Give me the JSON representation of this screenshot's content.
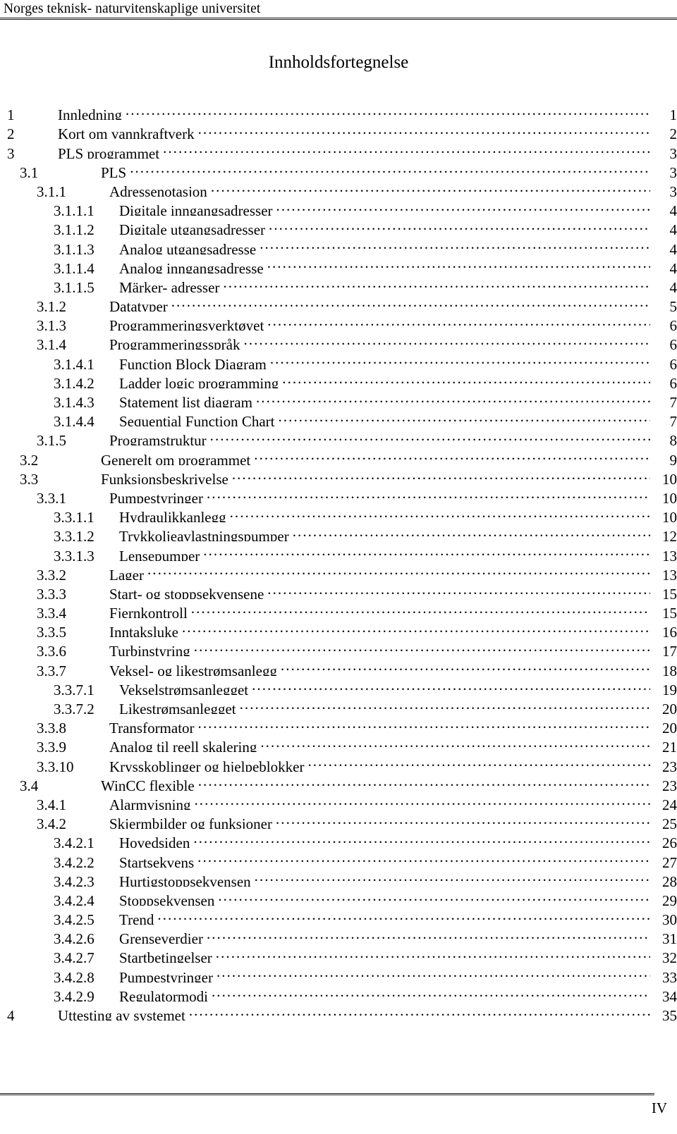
{
  "header": {
    "institution": "Norges teknisk- naturvitenskaplige universitet"
  },
  "title": "Innholdsfortegnelse",
  "footer": {
    "page_number": "IV"
  },
  "toc": {
    "entries": [
      {
        "level": 1,
        "number": "1",
        "title": "Innledning",
        "page": "1"
      },
      {
        "level": 1,
        "number": "2",
        "title": "Kort om vannkraftverk",
        "page": "2"
      },
      {
        "level": 1,
        "number": "3",
        "title": "PLS programmet",
        "page": "3"
      },
      {
        "level": 2,
        "number": "3.1",
        "title": "PLS",
        "page": "3"
      },
      {
        "level": 3,
        "number": "3.1.1",
        "title": "Adressenotasjon",
        "page": "3"
      },
      {
        "level": 4,
        "number": "3.1.1.1",
        "title": "Digitale inngangsadresser",
        "page": "4"
      },
      {
        "level": 4,
        "number": "3.1.1.2",
        "title": "Digitale utgangsadresser",
        "page": "4"
      },
      {
        "level": 4,
        "number": "3.1.1.3",
        "title": "Analog utgangsadresse",
        "page": "4"
      },
      {
        "level": 4,
        "number": "3.1.1.4",
        "title": "Analog inngangsadresse",
        "page": "4"
      },
      {
        "level": 4,
        "number": "3.1.1.5",
        "title": "Märker- adresser",
        "page": "4"
      },
      {
        "level": 3,
        "number": "3.1.2",
        "title": "Datatyper",
        "page": "5"
      },
      {
        "level": 3,
        "number": "3.1.3",
        "title": "Programmeringsverktøyet",
        "page": "6"
      },
      {
        "level": 3,
        "number": "3.1.4",
        "title": "Programmeringsspråk",
        "page": "6"
      },
      {
        "level": 4,
        "number": "3.1.4.1",
        "title": "Function Block Diagram",
        "page": "6"
      },
      {
        "level": 4,
        "number": "3.1.4.2",
        "title": "Ladder logic programming",
        "page": "6"
      },
      {
        "level": 4,
        "number": "3.1.4.3",
        "title": "Statement list diagram",
        "page": "7"
      },
      {
        "level": 4,
        "number": "3.1.4.4",
        "title": "Sequential Function Chart",
        "page": "7"
      },
      {
        "level": 3,
        "number": "3.1.5",
        "title": "Programstruktur",
        "page": "8"
      },
      {
        "level": 2,
        "number": "3.2",
        "title": "Generelt om programmet",
        "page": "9"
      },
      {
        "level": 2,
        "number": "3.3",
        "title": "Funksjonsbeskrivelse",
        "page": "10"
      },
      {
        "level": 3,
        "number": "3.3.1",
        "title": "Pumpestyringer",
        "page": "10"
      },
      {
        "level": 4,
        "number": "3.3.1.1",
        "title": "Hydraulikkanlegg",
        "page": "10"
      },
      {
        "level": 4,
        "number": "3.3.1.2",
        "title": "Trykkoljeavlastningspumper",
        "page": "12"
      },
      {
        "level": 4,
        "number": "3.3.1.3",
        "title": "Lensepumper",
        "page": "13"
      },
      {
        "level": 3,
        "number": "3.3.2",
        "title": "Lager",
        "page": "13"
      },
      {
        "level": 3,
        "number": "3.3.3",
        "title": "Start- og stoppsekvensene",
        "page": "15"
      },
      {
        "level": 3,
        "number": "3.3.4",
        "title": "Fjernkontroll",
        "page": "15"
      },
      {
        "level": 3,
        "number": "3.3.5",
        "title": "Inntaksluke",
        "page": "16"
      },
      {
        "level": 3,
        "number": "3.3.6",
        "title": "Turbinstyring",
        "page": "17"
      },
      {
        "level": 3,
        "number": "3.3.7",
        "title": "Veksel- og likestrømsanlegg",
        "page": "18"
      },
      {
        "level": 4,
        "number": "3.3.7.1",
        "title": "Vekselstrømsanlegget",
        "page": "19"
      },
      {
        "level": 4,
        "number": "3.3.7.2",
        "title": "Likestrømsanlegget",
        "page": "20"
      },
      {
        "level": 3,
        "number": "3.3.8",
        "title": "Transformator",
        "page": "20"
      },
      {
        "level": 3,
        "number": "3.3.9",
        "title": "Analog til reell skalering",
        "page": "21"
      },
      {
        "level": 3,
        "number": "3.3.10",
        "title": "Krysskoblinger og hjelpeblokker",
        "page": "23"
      },
      {
        "level": 2,
        "number": "3.4",
        "title": "WinCC flexible",
        "page": "23"
      },
      {
        "level": 3,
        "number": "3.4.1",
        "title": "Alarmvisning",
        "page": "24"
      },
      {
        "level": 3,
        "number": "3.4.2",
        "title": "Skjermbilder og funksjoner",
        "page": "25"
      },
      {
        "level": 4,
        "number": "3.4.2.1",
        "title": "Hovedsiden",
        "page": "26"
      },
      {
        "level": 4,
        "number": "3.4.2.2",
        "title": "Startsekvens",
        "page": "27"
      },
      {
        "level": 4,
        "number": "3.4.2.3",
        "title": "Hurtigstoppsekvensen",
        "page": "28"
      },
      {
        "level": 4,
        "number": "3.4.2.4",
        "title": "Stoppsekvensen",
        "page": "29"
      },
      {
        "level": 4,
        "number": "3.4.2.5",
        "title": "Trend",
        "page": "30"
      },
      {
        "level": 4,
        "number": "3.4.2.6",
        "title": "Grenseverdier",
        "page": "31"
      },
      {
        "level": 4,
        "number": "3.4.2.7",
        "title": "Startbetingelser",
        "page": "32"
      },
      {
        "level": 4,
        "number": "3.4.2.8",
        "title": "Pumpestyringer",
        "page": "33"
      },
      {
        "level": 4,
        "number": "3.4.2.9",
        "title": "Regulatormodi",
        "page": "34"
      },
      {
        "level": 1,
        "number": "4",
        "title": "Uttesting av systemet",
        "page": "35"
      }
    ]
  }
}
